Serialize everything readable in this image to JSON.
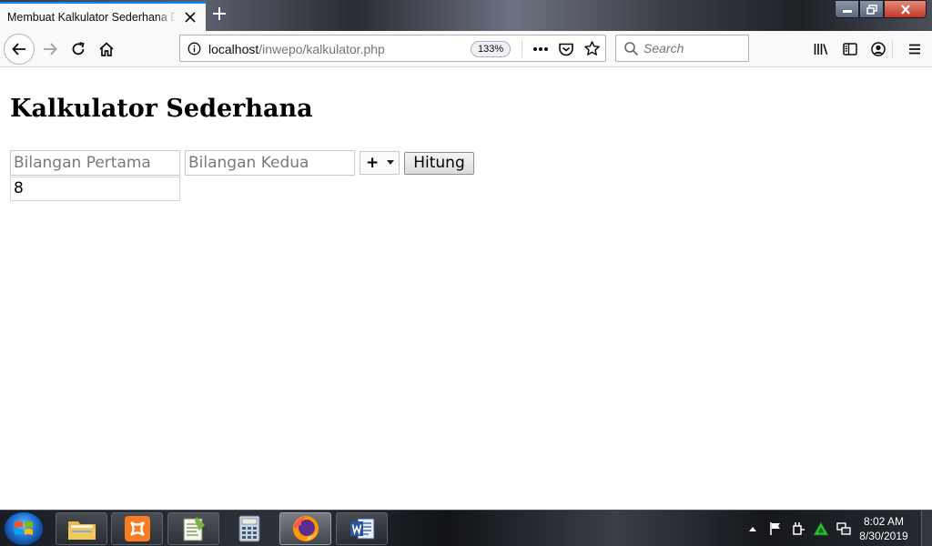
{
  "browser": {
    "tab": {
      "title": "Membuat Kalkulator Sederhana Dengan PHP"
    },
    "urlbar": {
      "host": "localhost",
      "path": "/inwepo/kalkulator.php"
    },
    "zoom": "133%",
    "search": {
      "placeholder": "Search"
    }
  },
  "page": {
    "title": "Kalkulator Sederhana",
    "form": {
      "first": {
        "placeholder": "Bilangan Pertama",
        "value": ""
      },
      "second": {
        "placeholder": "Bilangan Kedua",
        "value": ""
      },
      "operator": "+",
      "submit_label": "Hitung"
    },
    "result": "8"
  },
  "taskbar": {
    "items": [
      "explorer",
      "xampp",
      "notepad++",
      "calculator",
      "firefox",
      "word"
    ],
    "clock": {
      "time": "8:02 AM",
      "date": "8/30/2019"
    }
  },
  "colors": {
    "accent": "#0a84ff",
    "close": "#c4372a"
  }
}
